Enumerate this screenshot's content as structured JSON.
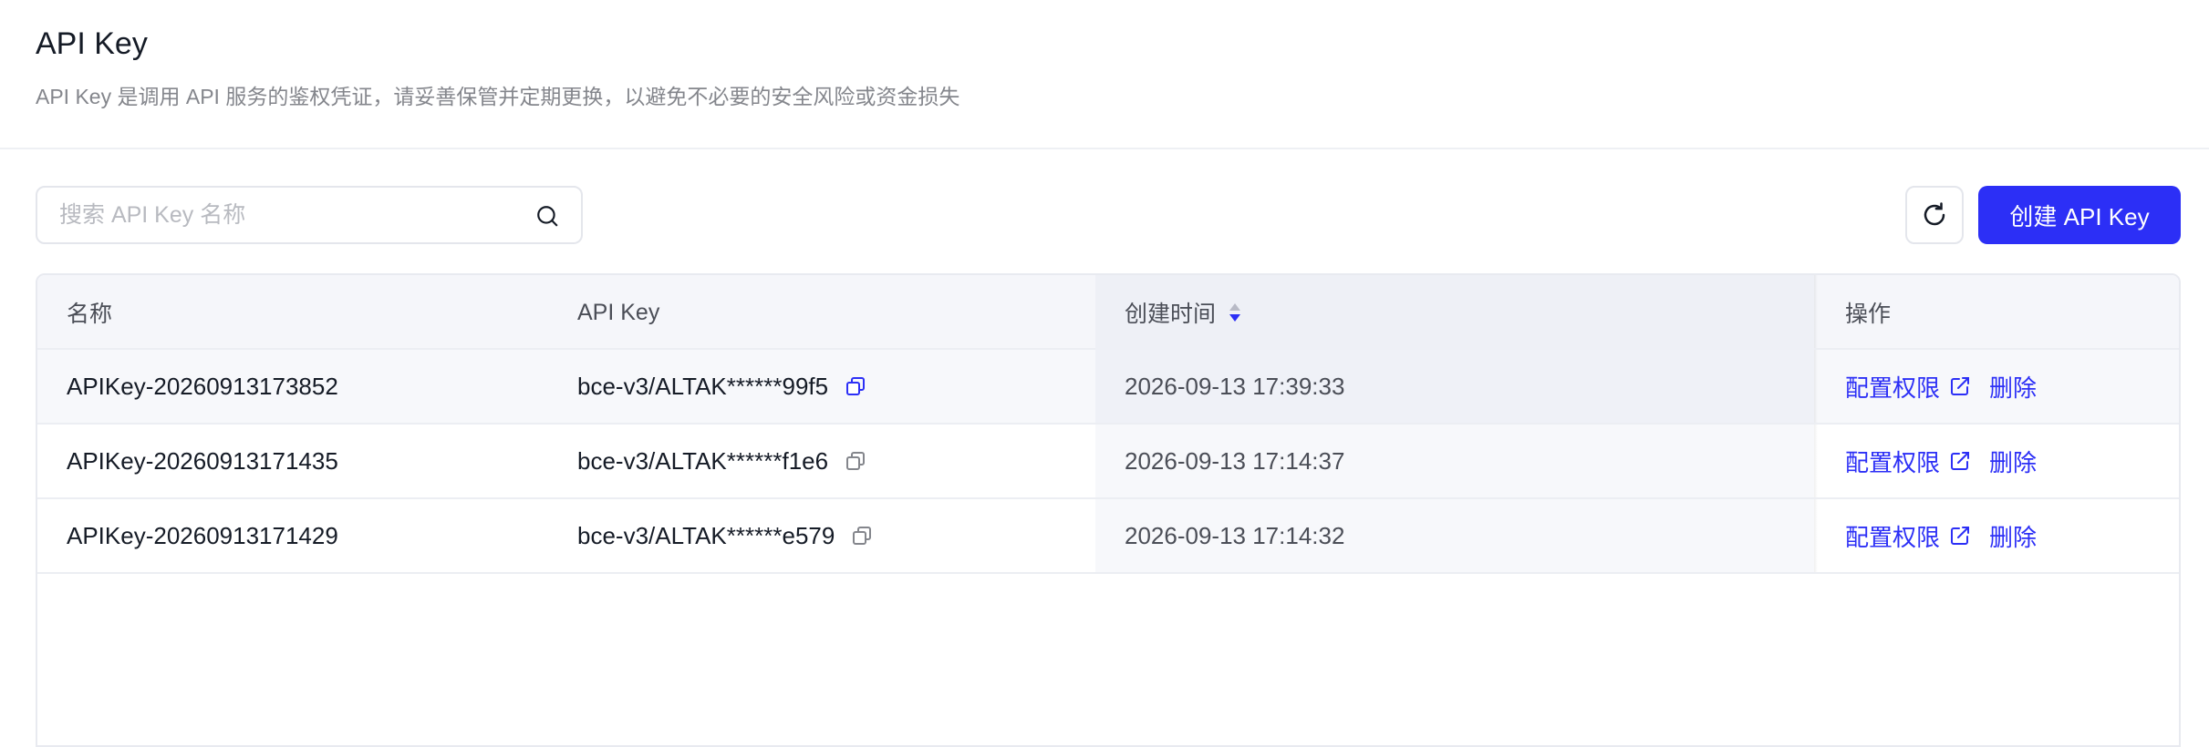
{
  "header": {
    "title": "API Key",
    "description": "API Key 是调用 API 服务的鉴权凭证，请妥善保管并定期更换，以避免不必要的安全风险或资金损失"
  },
  "toolbar": {
    "search_placeholder": "搜索 API Key 名称",
    "search_value": "",
    "create_label": "创建 API Key"
  },
  "table": {
    "columns": {
      "name": "名称",
      "api_key": "API Key",
      "created_time": "创建时间",
      "actions": "操作"
    },
    "sort": {
      "column": "created_time",
      "direction": "desc"
    },
    "rows": [
      {
        "name": "APIKey-20260913173852",
        "api_key": "bce-v3/ALTAK******99f5",
        "created_time": "2026-09-13 17:39:33",
        "config_label": "配置权限",
        "delete_label": "删除"
      },
      {
        "name": "APIKey-20260913171435",
        "api_key": "bce-v3/ALTAK******f1e6",
        "created_time": "2026-09-13 17:14:37",
        "config_label": "配置权限",
        "delete_label": "删除"
      },
      {
        "name": "APIKey-20260913171429",
        "api_key": "bce-v3/ALTAK******e579",
        "created_time": "2026-09-13 17:14:32",
        "config_label": "配置权限",
        "delete_label": "删除"
      }
    ]
  },
  "icons": {
    "search": "search-icon",
    "refresh": "refresh-icon",
    "sort": "sort-icon",
    "copy": "copy-icon",
    "external_link": "external-link-icon"
  },
  "colors": {
    "primary": "#2c2ff6",
    "text": "#151b26",
    "muted": "#84868c"
  }
}
